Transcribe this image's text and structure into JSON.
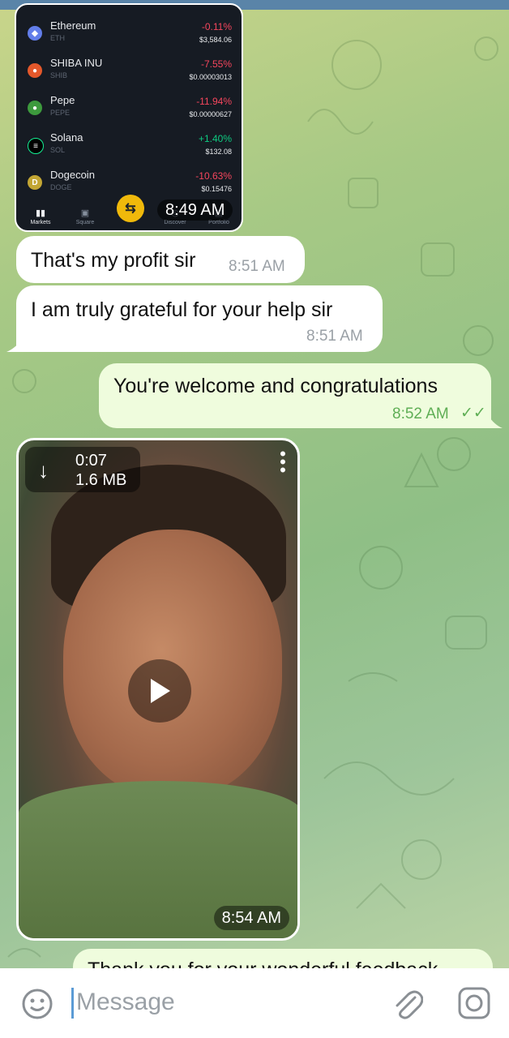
{
  "crypto_screenshot": {
    "coins": [
      {
        "name": "Ethereum",
        "symbol": "ETH",
        "change": "-0.11%",
        "price": "$3,584.06",
        "icon_color": "#627eea",
        "icon": "ethereum-icon"
      },
      {
        "name": "SHIBA INU",
        "symbol": "SHIB",
        "change": "-7.55%",
        "price": "$0.00003013",
        "icon_color": "#e4582b",
        "icon": "shiba-icon"
      },
      {
        "name": "Pepe",
        "symbol": "PEPE",
        "change": "-11.94%",
        "price": "$0.00000627",
        "icon_color": "#3d9a3d",
        "icon": "pepe-icon"
      },
      {
        "name": "Solana",
        "symbol": "SOL",
        "change": "+1.40%",
        "price": "$132.08",
        "icon_color": "#14f195",
        "icon": "solana-icon"
      },
      {
        "name": "Dogecoin",
        "symbol": "DOGE",
        "change": "-10.63%",
        "price": "$0.15476",
        "icon_color": "#c3a634",
        "icon": "dogecoin-icon"
      }
    ],
    "nav": {
      "markets": "Markets",
      "square": "Square",
      "discover": "Discover",
      "portfolio": "Portfolio"
    },
    "time": "8:49 AM",
    "colors": {
      "negative": "#f6465d",
      "positive": "#0ecb81",
      "trade": "#f0b90b"
    }
  },
  "messages": [
    {
      "text": "That's my profit sir",
      "time": "8:51 AM",
      "direction": "incoming"
    },
    {
      "text": "I am truly grateful for your help sir",
      "time": "8:51 AM",
      "direction": "incoming"
    },
    {
      "text": "You're welcome and congratulations",
      "time": "8:52 AM",
      "direction": "outgoing",
      "status": "read"
    }
  ],
  "video": {
    "duration": "0:07",
    "size": "1.6 MB",
    "time": "8:54 AM"
  },
  "partial_message": {
    "text": "Thank you for your wonderful feedback"
  },
  "composer": {
    "placeholder": "Message"
  },
  "colors": {
    "outgoing_bubble": "#effcdd",
    "incoming_bubble": "#ffffff",
    "read_check": "#5fae55",
    "header": "#5a84a8"
  }
}
